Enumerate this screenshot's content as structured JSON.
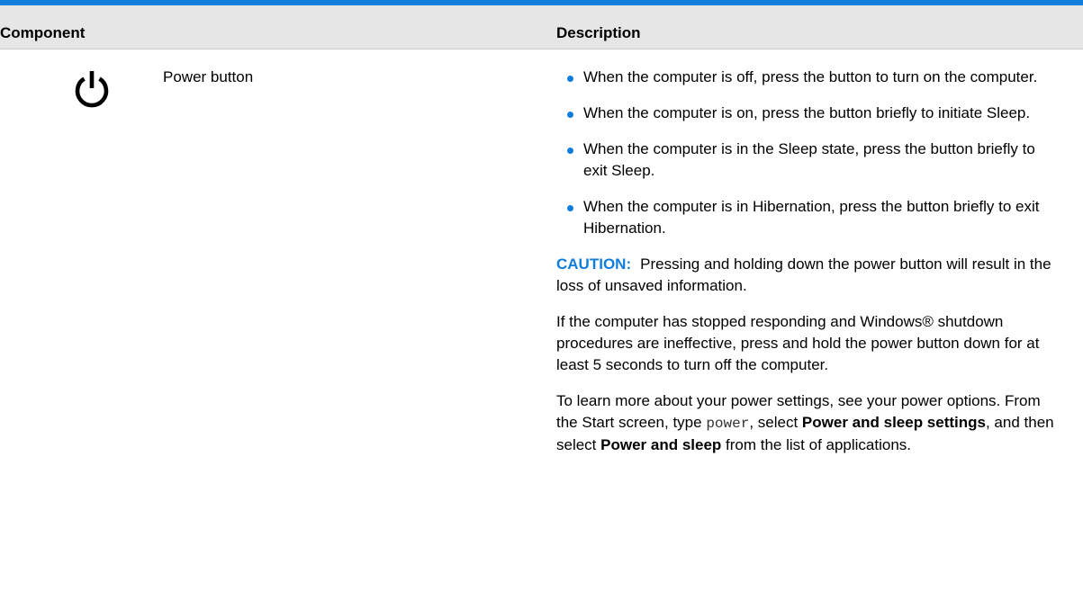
{
  "table": {
    "headers": {
      "component": "Component",
      "description": "Description"
    },
    "row": {
      "icon": "power-icon",
      "component_label": "Power button",
      "bullets": [
        "When the computer is off, press the button to turn on the computer.",
        "When the computer is on, press the button briefly to initiate Sleep.",
        "When the computer is in the Sleep state, press the button briefly to exit Sleep.",
        "When the computer is in Hibernation, press the button briefly to exit Hibernation."
      ],
      "caution": {
        "label": "CAUTION:",
        "text": "Pressing and holding down the power button will result in the loss of unsaved information."
      },
      "paragraph_shutdown": "If the computer has stopped responding and Windows® shutdown procedures are ineffective, press and hold the power button down for at least 5 seconds to turn off the computer.",
      "paragraph_settings": {
        "part1": "To learn more about your power settings, see your power options. From the Start screen, type ",
        "code": "power",
        "part2": ", select ",
        "bold1": "Power and sleep settings",
        "part3": ", and then select ",
        "bold2": "Power and sleep",
        "part4": " from the list of applications."
      }
    }
  },
  "colors": {
    "accent_blue": "#0f7ddc",
    "header_gray": "#e6e6e6"
  }
}
